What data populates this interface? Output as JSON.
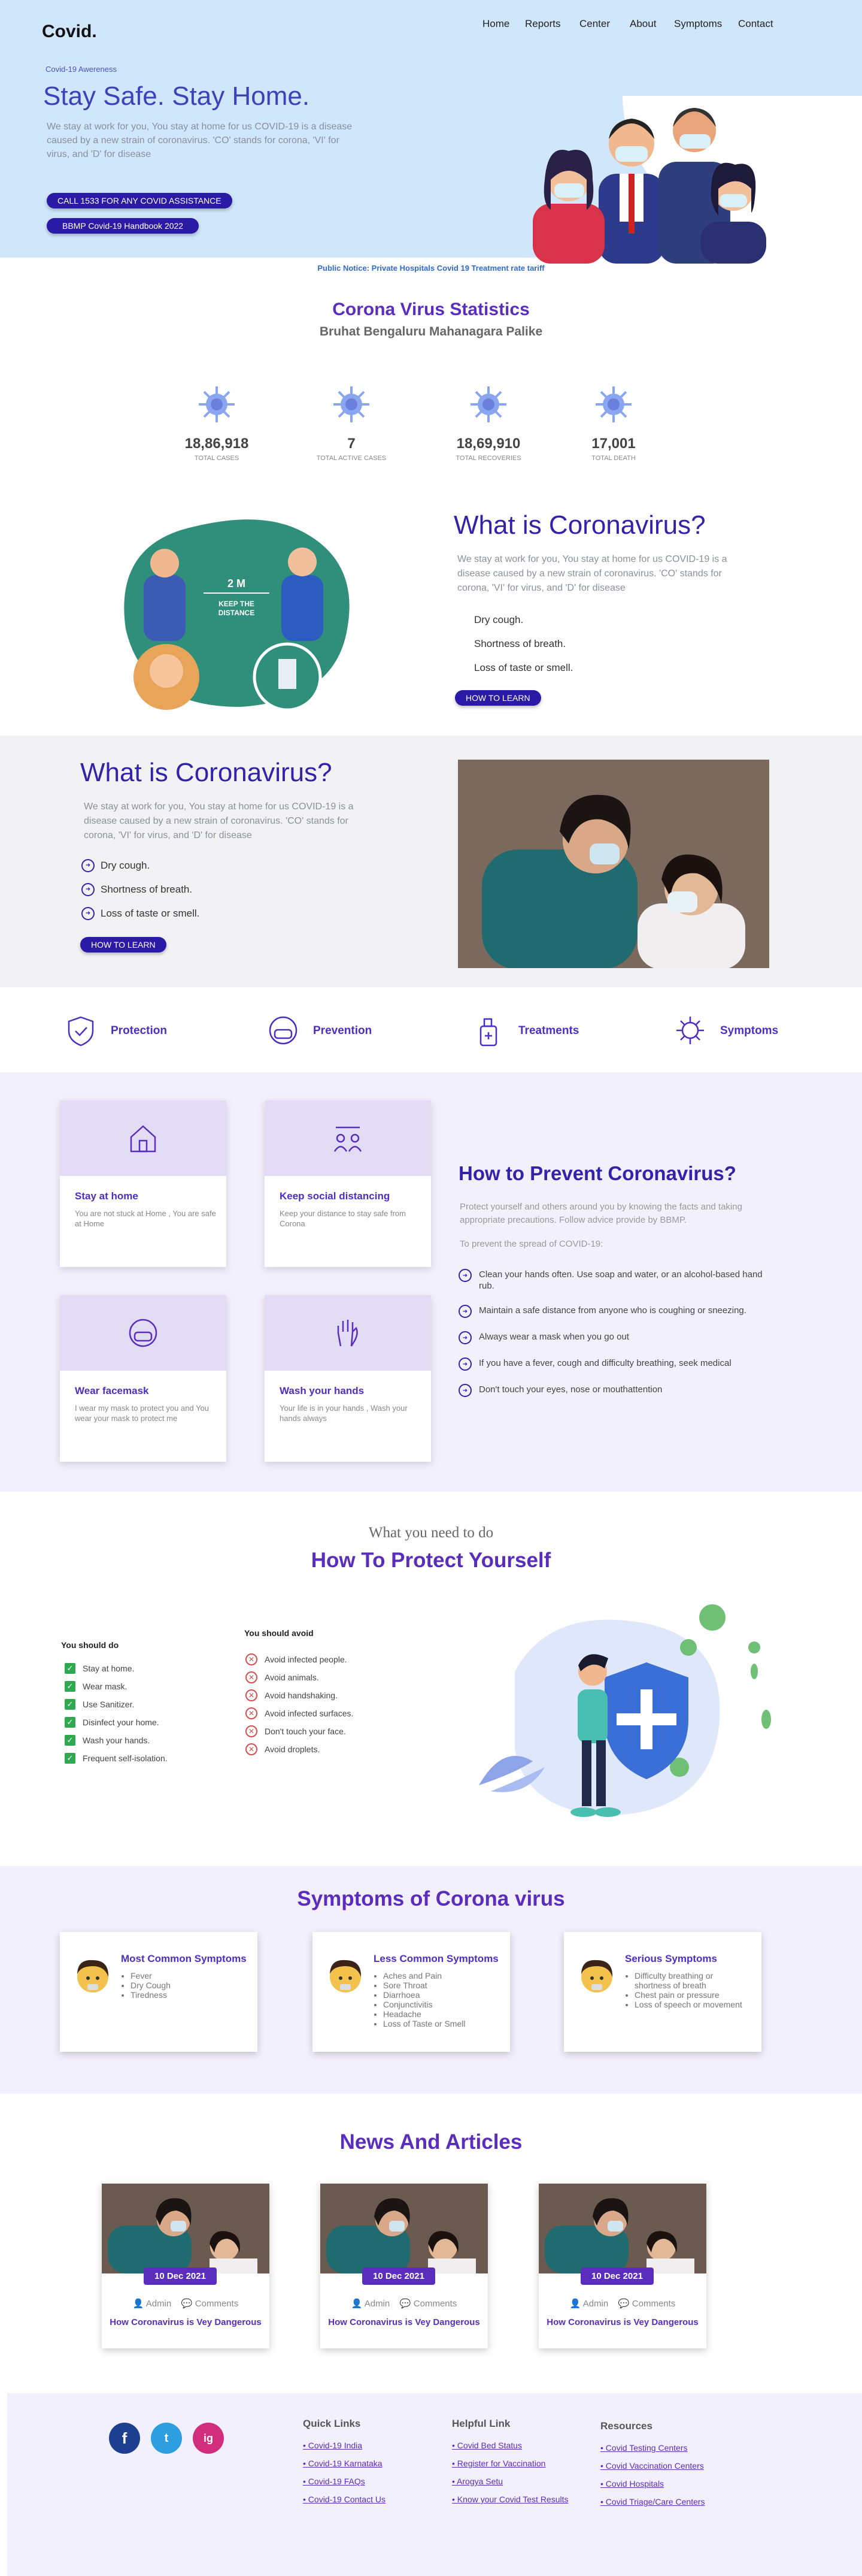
{
  "brand": "Covid.",
  "nav": [
    "Home",
    "Reports",
    "Center",
    "About",
    "Symptoms",
    "Contact"
  ],
  "hero": {
    "tag": "Covid-19 Awereness",
    "title": "Stay Safe. Stay Home.",
    "desc": "We stay at work for you, You stay at home for us COVID-19 is a disease caused by a new strain of coronavirus. 'CO' stands for corona, 'VI' for virus, and 'D' for disease",
    "btn1": "CALL 1533 FOR ANY COVID ASSISTANCE",
    "btn2": "BBMP Covid-19 Handbook 2022"
  },
  "notice": "Public Notice: Private Hospitals Covid 19 Treatment rate tariff",
  "stats": {
    "title": "Corona Virus Statistics",
    "subtitle": "Bruhat Bengaluru Mahanagara Palike",
    "items": [
      {
        "value": "18,86,918",
        "label": "Total cases"
      },
      {
        "value": "7",
        "label": "Total active cases"
      },
      {
        "value": "18,69,910",
        "label": "Total Recoveries"
      },
      {
        "value": "17,001",
        "label": "Total death"
      }
    ]
  },
  "what1": {
    "title": "What is Coronavirus?",
    "desc": "We stay at work for you, You stay at home for us COVID-19 is a disease caused by a new strain of coronavirus. 'CO' stands for corona, 'VI' for virus, and 'D' for disease",
    "items": [
      "Dry cough.",
      "Shortness of breath.",
      "Loss of taste or smell."
    ],
    "btn": "HOW TO LEARN",
    "illus_text": [
      "2 M",
      "KEEP THE",
      "DISTANCE"
    ]
  },
  "what2": {
    "title": "What is Coronavirus?",
    "desc": "We stay at work for you, You stay at home for us COVID-19 is a disease caused by a new strain of coronavirus. 'CO' stands for corona, 'VI' for virus, and 'D' for disease",
    "items": [
      "Dry cough.",
      "Shortness of breath.",
      "Loss of taste or smell."
    ],
    "btn": "HOW TO LEARN"
  },
  "features": [
    "Protection",
    "Prevention",
    "Treatments",
    "Symptoms"
  ],
  "prevent": {
    "cards": [
      {
        "title": "Stay at home",
        "desc": "You are not stuck at Home , You are safe at Home"
      },
      {
        "title": "Keep social distancing",
        "desc": "Keep your distance to stay safe from Corona"
      },
      {
        "title": "Wear facemask",
        "desc": "I wear my mask to protect you and You wear your mask to protect me"
      },
      {
        "title": "Wash your hands",
        "desc": "Your life is in your hands , Wash your hands always"
      }
    ],
    "title": "How to Prevent Coronavirus?",
    "desc": "Protect yourself and others around you by knowing the facts and taking appropriate precautions. Follow advice provide by BBMP.",
    "sub": "To prevent the spread of COVID-19:",
    "items": [
      "Clean your hands often. Use soap and water, or an alcohol-based hand rub.",
      "Maintain a safe distance from anyone who is coughing or sneezing.",
      "Always wear a mask when you go out",
      "If you have a fever, cough and difficulty breathing, seek medical",
      "Don't touch your eyes, nose or mouthattention"
    ]
  },
  "protect": {
    "kicker": "What you need to do",
    "title": "How To Protect Yourself",
    "do_title": "You should do",
    "do": [
      "Stay at home.",
      "Wear mask.",
      "Use Sanitizer.",
      "Disinfect your home.",
      "Wash your hands.",
      "Frequent self-isolation."
    ],
    "avoid_title": "You should avoid",
    "avoid": [
      "Avoid infected people.",
      "Avoid animals.",
      "Avoid handshaking.",
      "Avoid infected surfaces.",
      "Don't touch your face.",
      "Avoid droplets."
    ]
  },
  "symptoms": {
    "title": "Symptoms of Corona virus",
    "cards": [
      {
        "title": "Most Common Symptoms",
        "items": [
          "Fever",
          "Dry Cough",
          "Tiredness"
        ]
      },
      {
        "title": "Less Common Symptoms",
        "items": [
          "Aches and Pain",
          "Sore Throat",
          "Diarrhoea",
          "Conjunctivitis",
          "Headache",
          "Loss of Taste or Smell"
        ]
      },
      {
        "title": "Serious Symptoms",
        "items": [
          "Difficulty breathing or shortness of breath",
          "Chest pain or pressure",
          "Loss of speech or movement"
        ]
      }
    ]
  },
  "news": {
    "title": "News And Articles",
    "items": [
      {
        "date": "10 Dec 2021",
        "author": "Admin",
        "comments": "Comments",
        "title": "How Coronavirus is Vey Dangerous"
      },
      {
        "date": "10 Dec 2021",
        "author": "Admin",
        "comments": "Comments",
        "title": "How Coronavirus is Vey Dangerous"
      },
      {
        "date": "10 Dec 2021",
        "author": "Admin",
        "comments": "Comments",
        "title": "How Coronavirus is Vey Dangerous"
      }
    ]
  },
  "footer": {
    "social": [
      "f",
      "t",
      "ig"
    ],
    "cols": [
      {
        "title": "Quick Links",
        "links": [
          "Covid-19 India",
          "Covid-19 Karnataka",
          "Covid-19 FAQs",
          "Covid-19 Contact Us"
        ]
      },
      {
        "title": "Helpful Link",
        "links": [
          "Covid Bed Status",
          "Register for Vaccination",
          "Arogya Setu",
          "Know your Covid Test Results"
        ]
      },
      {
        "title": "Resources",
        "links": [
          "Covid Testing Centers",
          "Covid Vaccination Centers",
          "Covid Hospitals",
          "Covid Triage/Care Centers"
        ]
      }
    ]
  },
  "colors": {
    "accent": "#5b2dbd",
    "button": "#2a1aa6",
    "hero_bg": "#cfe6fb",
    "band": "#f3f0fd"
  }
}
